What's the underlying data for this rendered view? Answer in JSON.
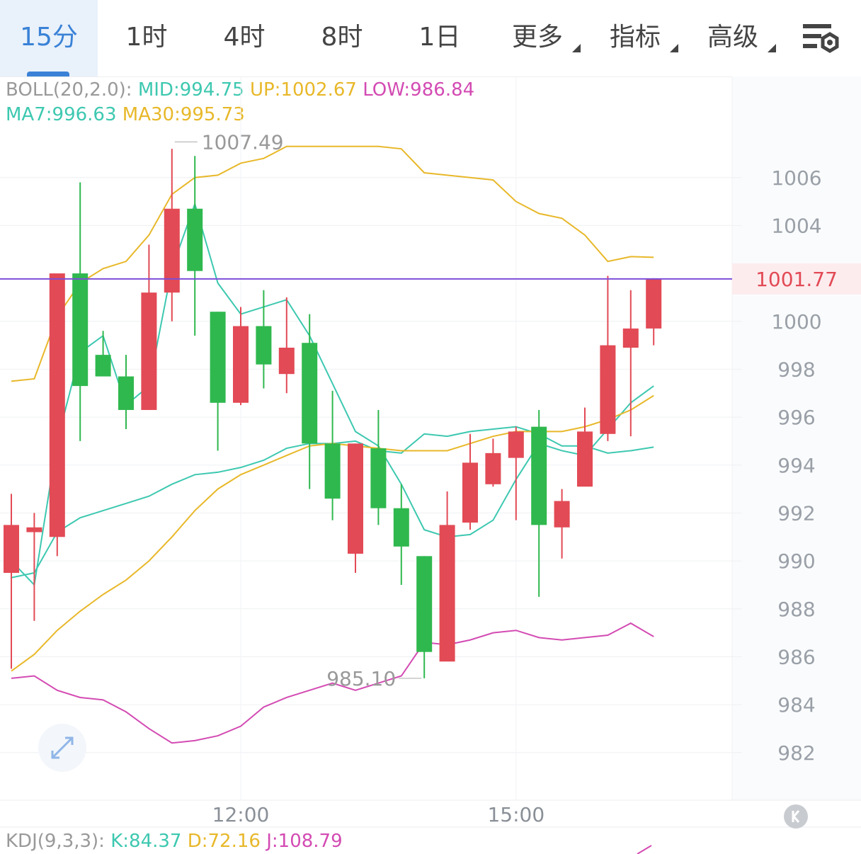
{
  "tabs": [
    {
      "label": "15分",
      "active": true
    },
    {
      "label": "1时"
    },
    {
      "label": "4时"
    },
    {
      "label": "8时"
    },
    {
      "label": "1日"
    },
    {
      "label": "更多",
      "dropdown": true
    },
    {
      "label": "指标",
      "dropdown": true
    },
    {
      "label": "高级",
      "dropdown": true
    }
  ],
  "settings_icon": "chart-settings-icon",
  "boll": {
    "label": "BOLL(20,2.0):",
    "mid": "MID:994.75",
    "up": "UP:1002.67",
    "low": "LOW:986.84"
  },
  "ma": {
    "ma7": "MA7:996.63",
    "ma30": "MA30:995.73"
  },
  "kdj": {
    "label": "KDJ(9,3,3):",
    "k": "K:84.37",
    "d": "D:72.16",
    "j": "J:108.79"
  },
  "colors": {
    "up": "#e24a55",
    "down": "#2fb84e",
    "ma7": "#3dc8b0",
    "ma30": "#e8b82a",
    "boll_band": "#d34bb3",
    "price_line": "#7d4ed8",
    "accent": "#3a82d6"
  },
  "chart_data": {
    "type": "candlestick",
    "x_labels": [
      "12:00",
      "15:00"
    ],
    "x_label_index": [
      10,
      22
    ],
    "y_ticks": [
      1006,
      1004,
      1000,
      998,
      996,
      994,
      992,
      990,
      988,
      986,
      984,
      982
    ],
    "last_price": "1001.77",
    "high_label": "1007.49",
    "low_label": "985.10",
    "ylim": [
      980.9,
      1007.5
    ],
    "candles": [
      {
        "o": 989.5,
        "h": 992.8,
        "l": 985.5,
        "c": 991.5
      },
      {
        "o": 991.2,
        "h": 992.0,
        "l": 987.5,
        "c": 991.4
      },
      {
        "o": 991.0,
        "h": 996.5,
        "l": 990.2,
        "c": 1002.0
      },
      {
        "o": 1002.0,
        "h": 1005.8,
        "l": 995.0,
        "c": 997.3
      },
      {
        "o": 998.6,
        "h": 999.6,
        "l": 998.0,
        "c": 997.7
      },
      {
        "o": 997.7,
        "h": 998.6,
        "l": 995.5,
        "c": 996.3
      },
      {
        "o": 996.3,
        "h": 1003.2,
        "l": 996.3,
        "c": 1001.2
      },
      {
        "o": 1001.2,
        "h": 1007.2,
        "l": 1000.0,
        "c": 1004.7
      },
      {
        "o": 1004.7,
        "h": 1006.9,
        "l": 999.4,
        "c": 1002.1
      },
      {
        "o": 1000.4,
        "h": 1000.4,
        "l": 994.6,
        "c": 996.6
      },
      {
        "o": 996.6,
        "h": 1000.6,
        "l": 996.5,
        "c": 999.8
      },
      {
        "o": 999.8,
        "h": 1001.3,
        "l": 997.2,
        "c": 998.2
      },
      {
        "o": 997.8,
        "h": 1001.0,
        "l": 997.0,
        "c": 998.9
      },
      {
        "o": 999.1,
        "h": 1000.3,
        "l": 993.0,
        "c": 994.9
      },
      {
        "o": 994.9,
        "h": 997.1,
        "l": 991.7,
        "c": 992.6
      },
      {
        "o": 990.3,
        "h": 994.9,
        "l": 989.5,
        "c": 994.9
      },
      {
        "o": 994.7,
        "h": 996.3,
        "l": 991.5,
        "c": 992.2
      },
      {
        "o": 992.2,
        "h": 993.2,
        "l": 989.0,
        "c": 990.6
      },
      {
        "o": 990.2,
        "h": 990.2,
        "l": 985.1,
        "c": 986.2
      },
      {
        "o": 985.8,
        "h": 992.9,
        "l": 986.0,
        "c": 991.5
      },
      {
        "o": 991.6,
        "h": 995.3,
        "l": 991.3,
        "c": 994.1
      },
      {
        "o": 993.2,
        "h": 995.1,
        "l": 993.1,
        "c": 994.5
      },
      {
        "o": 994.3,
        "h": 995.6,
        "l": 991.7,
        "c": 995.4
      },
      {
        "o": 995.6,
        "h": 996.3,
        "l": 988.5,
        "c": 991.5
      },
      {
        "o": 991.4,
        "h": 993.0,
        "l": 990.1,
        "c": 992.5
      },
      {
        "o": 993.1,
        "h": 996.4,
        "l": 993.2,
        "c": 995.4
      },
      {
        "o": 995.3,
        "h": 1001.9,
        "l": 995.0,
        "c": 999.0
      },
      {
        "o": 998.9,
        "h": 1001.3,
        "l": 995.2,
        "c": 999.7
      },
      {
        "o": 999.7,
        "h": 1001.8,
        "l": 999.0,
        "c": 1001.77
      }
    ],
    "boll_up": [
      997.5,
      997.6,
      1000.2,
      1001.6,
      1002.2,
      1002.5,
      1003.6,
      1005.3,
      1006.0,
      1006.1,
      1006.6,
      1006.8,
      1007.3,
      1007.3,
      1007.3,
      1007.3,
      1007.3,
      1007.2,
      1006.2,
      1006.1,
      1006.0,
      1005.9,
      1005.0,
      1004.5,
      1004.3,
      1003.6,
      1002.5,
      1002.7,
      1002.67
    ],
    "boll_mid": [
      989.3,
      989.5,
      991.2,
      991.8,
      992.1,
      992.4,
      992.7,
      993.2,
      993.6,
      993.7,
      993.9,
      994.2,
      994.7,
      994.9,
      994.9,
      995.0,
      994.6,
      994.5,
      995.3,
      995.2,
      995.4,
      995.5,
      995.6,
      995.3,
      994.8,
      994.8,
      994.5,
      994.6,
      994.75
    ],
    "boll_low": [
      985.1,
      985.2,
      984.6,
      984.3,
      984.2,
      983.7,
      983.0,
      982.4,
      982.5,
      982.7,
      983.1,
      983.9,
      984.3,
      984.6,
      984.9,
      984.6,
      984.9,
      985.2,
      986.6,
      986.5,
      986.7,
      987.0,
      987.1,
      986.8,
      986.7,
      986.8,
      986.9,
      987.4,
      986.84
    ],
    "ma7": [
      990.0,
      989.0,
      995.0,
      998.7,
      999.4,
      996.5,
      997.3,
      1002.2,
      1004.9,
      1001.6,
      1000.3,
      1000.6,
      1000.9,
      999.4,
      997.4,
      995.4,
      994.8,
      993.2,
      991.3,
      991.0,
      991.1,
      991.7,
      993.4,
      994.9,
      994.6,
      994.4,
      995.5,
      996.6,
      997.3
    ],
    "ma30": [
      985.4,
      986.1,
      987.1,
      987.9,
      988.6,
      989.2,
      990.0,
      991.0,
      992.1,
      993.0,
      993.6,
      994.0,
      994.4,
      994.8,
      994.9,
      994.8,
      994.7,
      994.6,
      994.6,
      994.6,
      994.9,
      995.2,
      995.4,
      995.4,
      995.4,
      995.6,
      995.9,
      996.3,
      996.9
    ]
  }
}
